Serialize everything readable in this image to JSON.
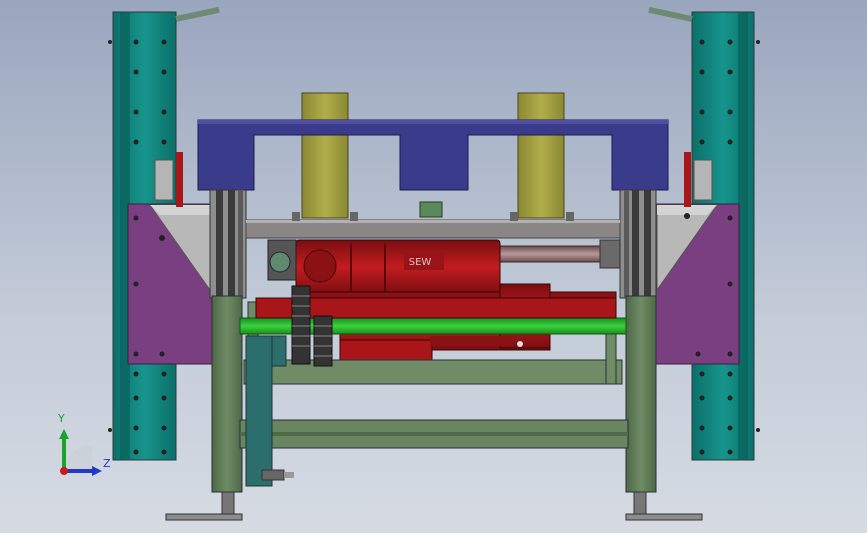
{
  "triad": {
    "y_label": "Y",
    "z_label": "Z",
    "y_color": "#1aa32a",
    "z_color": "#2437c8",
    "x_color": "#c81b1b"
  },
  "motor": {
    "brand_text": "SEW"
  },
  "palette": {
    "teal_post": "#0f8a82",
    "purple_plate": "#7a3f80",
    "navy_beam": "#3b3b8c",
    "olive_block": "#9c9a3c",
    "red_motor": "#a8161a",
    "green_frame": "#5f7a55",
    "bright_green_shaft": "#27b12a"
  }
}
